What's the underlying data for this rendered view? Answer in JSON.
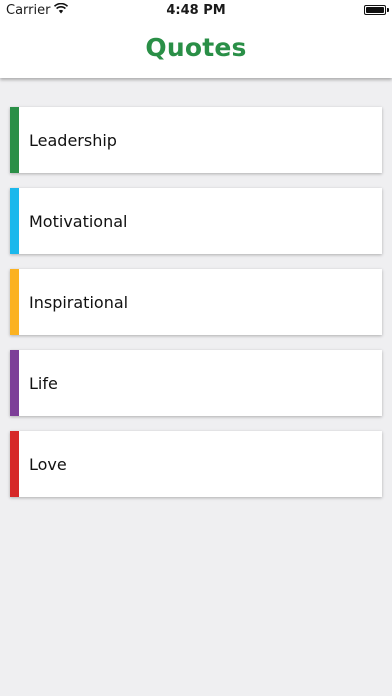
{
  "status_bar": {
    "carrier": "Carrier",
    "wifi_icon": "wifi-icon",
    "time": "4:48 PM",
    "battery_icon": "battery-full-icon"
  },
  "nav": {
    "title": "Quotes",
    "title_color": "#2a8f47"
  },
  "categories": [
    {
      "label": "Leadership",
      "color": "#2a8f47"
    },
    {
      "label": "Motivational",
      "color": "#1bb8ec"
    },
    {
      "label": "Inspirational",
      "color": "#fbb221"
    },
    {
      "label": "Life",
      "color": "#7d3f98"
    },
    {
      "label": "Love",
      "color": "#d62828"
    }
  ]
}
